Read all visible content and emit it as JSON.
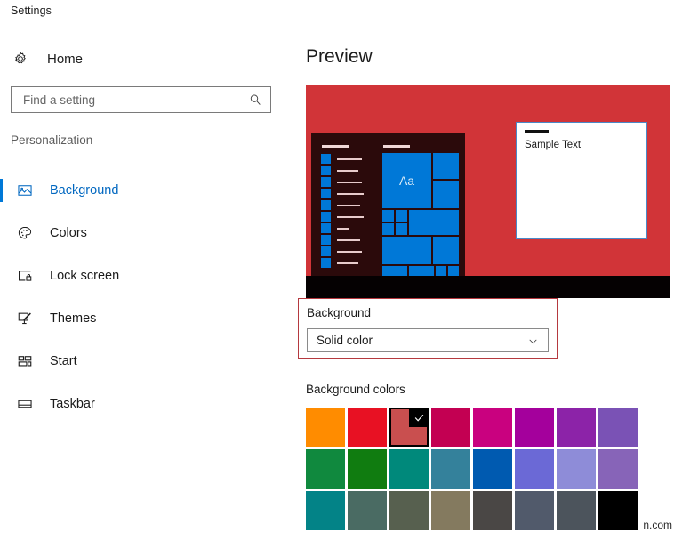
{
  "window": {
    "title": "Settings"
  },
  "nav": {
    "home_label": "Home",
    "home_icon": "gear-icon",
    "search": {
      "value": "",
      "placeholder": "Find a setting",
      "icon": "search-icon"
    },
    "section_label": "Personalization",
    "items": [
      {
        "label": "Background",
        "icon": "picture-icon",
        "selected": true
      },
      {
        "label": "Colors",
        "icon": "palette-icon",
        "selected": false
      },
      {
        "label": "Lock screen",
        "icon": "lock-screen-icon",
        "selected": false
      },
      {
        "label": "Themes",
        "icon": "brush-icon",
        "selected": false
      },
      {
        "label": "Start",
        "icon": "start-tiles-icon",
        "selected": false
      },
      {
        "label": "Taskbar",
        "icon": "taskbar-icon",
        "selected": false
      }
    ]
  },
  "content": {
    "page_title": "Preview",
    "preview": {
      "desktop_color": "#d13438",
      "taskbar_color": "#050102",
      "start_menu_color": "#2b0a0b",
      "tile_color": "#0078d7",
      "tile_text": "Aa",
      "sample_window": {
        "text": "Sample Text",
        "border_color": "#4a89c8"
      }
    },
    "background_group": {
      "label": "Background",
      "highlight_color": "#b5393f",
      "select": {
        "value": "Solid color",
        "chevron_icon": "chevron-down-icon"
      }
    },
    "colors": {
      "label": "Background colors",
      "selected_index": 2,
      "check_icon": "check-icon",
      "rows": [
        [
          "#ff8c00",
          "#e81123",
          "#c94f4f",
          "#c30052",
          "#c9017f",
          "#a4009c",
          "#8c23a8",
          "#7a52b5"
        ],
        [
          "#10893e",
          "#107c10",
          "#00897b",
          "#34819b",
          "#005ab0",
          "#6b69d6",
          "#8e8cd8",
          "#8764b8"
        ],
        [
          "#038387",
          "#4a6b63",
          "#57604f",
          "#847a5f",
          "#4a4745",
          "#515a6b",
          "#4c545c",
          "#000000"
        ]
      ]
    }
  },
  "watermark": {
    "text": "n.com"
  }
}
